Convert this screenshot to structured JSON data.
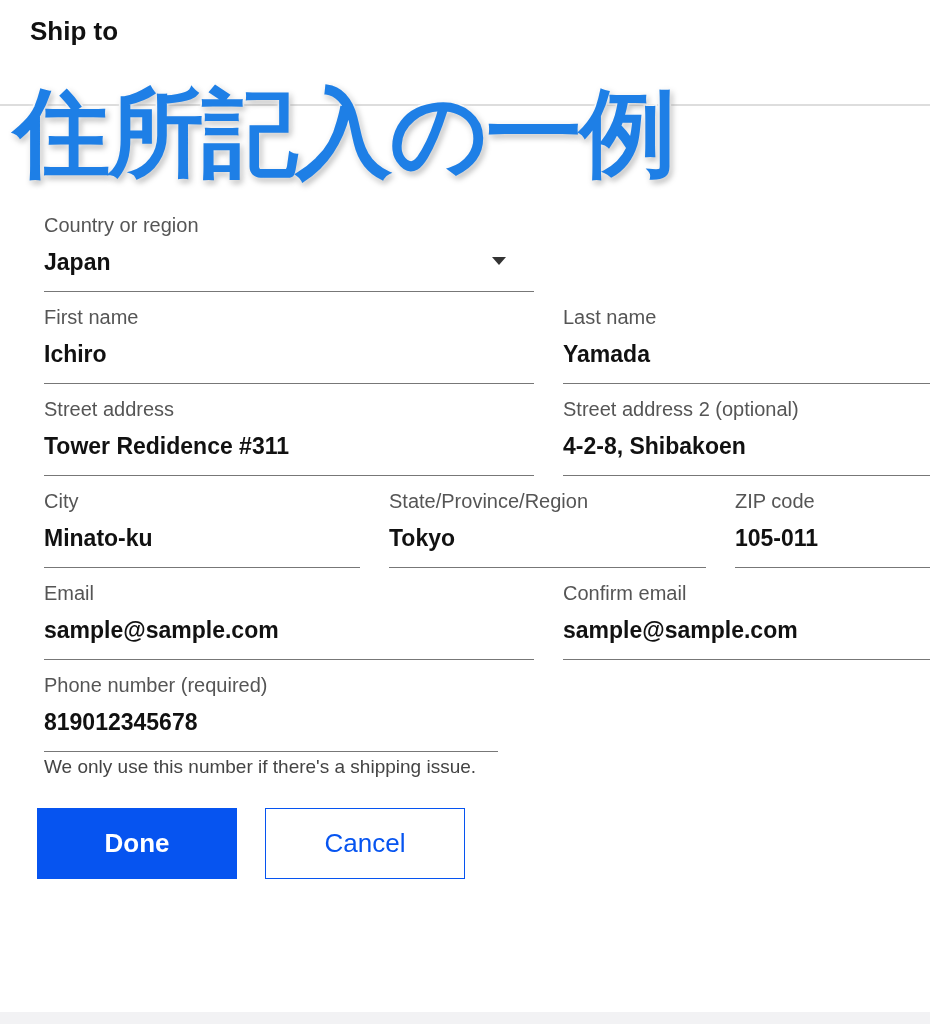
{
  "title": "Ship to",
  "caption": "住所記入の一例",
  "rows": [
    [
      {
        "kind": "select",
        "label": "Country or region",
        "value": "Japan"
      }
    ],
    [
      {
        "kind": "text",
        "label": "First name",
        "value": "Ichiro"
      },
      {
        "kind": "text",
        "label": "Last name",
        "value": "Yamada"
      }
    ],
    [
      {
        "kind": "text",
        "label": "Street address",
        "value": "Tower Redidence #311"
      },
      {
        "kind": "text",
        "label": "Street address 2 (optional)",
        "value": "4-2-8, Shibakoen"
      }
    ],
    [
      {
        "kind": "text",
        "label": "City",
        "value": "Minato-ku"
      },
      {
        "kind": "text",
        "label": "State/Province/Region",
        "value": "Tokyo"
      },
      {
        "kind": "text",
        "label": "ZIP code",
        "value": "105-011"
      }
    ],
    [
      {
        "kind": "text",
        "label": "Email",
        "value": "sample@sample.com"
      },
      {
        "kind": "text",
        "label": "Confirm email",
        "value": "sample@sample.com"
      }
    ],
    [
      {
        "kind": "text",
        "label": "Phone number (required)",
        "value": "819012345678",
        "hint": "We only use this number if there's a shipping issue."
      }
    ]
  ],
  "buttons": [
    {
      "kind": "primary",
      "label": "Done"
    },
    {
      "kind": "secondary",
      "label": "Cancel"
    }
  ]
}
